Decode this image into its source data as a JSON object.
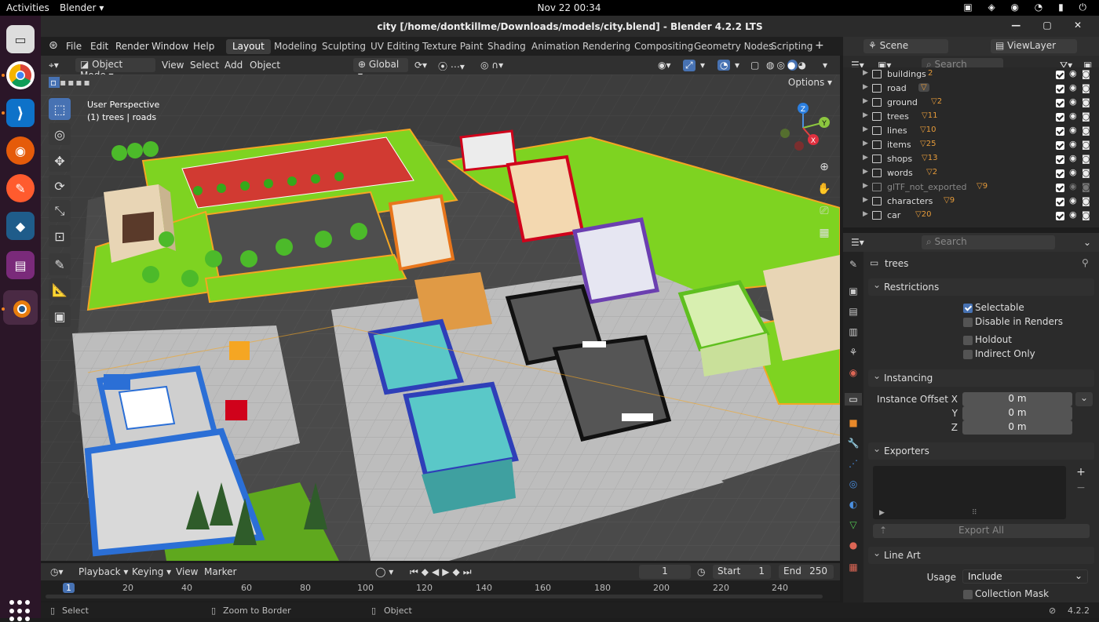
{
  "system": {
    "activities": "Activities",
    "app_name": "Blender",
    "clock": "Nov 22  00:34"
  },
  "window": {
    "title": "city [/home/dontkillme/Downloads/models/city.blend] - Blender 4.2.2 LTS"
  },
  "menu": {
    "items": [
      "File",
      "Edit",
      "Render",
      "Window",
      "Help"
    ]
  },
  "workspaces": {
    "tabs": [
      "Layout",
      "Modeling",
      "Sculpting",
      "UV Editing",
      "Texture Paint",
      "Shading",
      "Animation",
      "Rendering",
      "Compositing",
      "Geometry Nodes",
      "Scripting"
    ],
    "active": "Layout",
    "add": "+"
  },
  "scene": {
    "label": "Scene",
    "view_layer": "ViewLayer"
  },
  "viewport_header": {
    "mode": "Object Mode",
    "menus": [
      "View",
      "Select",
      "Add",
      "Object"
    ],
    "transform": "Global",
    "options": "Options"
  },
  "viewport": {
    "perspective": "User Perspective",
    "context": "(1) trees | roads"
  },
  "gizmo": {
    "x": "X",
    "y": "Y",
    "z": "Z"
  },
  "outliner": {
    "search_placeholder": "Search",
    "rows": [
      {
        "name": "buildings",
        "count": "2"
      },
      {
        "name": "road",
        "count": ""
      },
      {
        "name": "ground",
        "count": "2"
      },
      {
        "name": "trees",
        "count": "11"
      },
      {
        "name": "lines",
        "count": "10"
      },
      {
        "name": "items",
        "count": "25"
      },
      {
        "name": "shops",
        "count": "13"
      },
      {
        "name": "words",
        "count": "2"
      },
      {
        "name": "glTF_not_exported",
        "count": "9"
      },
      {
        "name": "characters",
        "count": "9"
      },
      {
        "name": "car",
        "count": "20"
      }
    ]
  },
  "properties": {
    "search_placeholder": "Search",
    "collection_name": "trees",
    "restrictions": {
      "title": "Restrictions",
      "selectable": "Selectable",
      "disable_renders": "Disable in Renders",
      "holdout": "Holdout",
      "indirect_only": "Indirect Only"
    },
    "instancing": {
      "title": "Instancing",
      "offset_x_label": "Instance Offset X",
      "y_label": "Y",
      "z_label": "Z",
      "x": "0 m",
      "y": "0 m",
      "z": "0 m"
    },
    "exporters": {
      "title": "Exporters",
      "export_all": "Export All"
    },
    "line_art": {
      "title": "Line Art",
      "usage_label": "Usage",
      "usage": "Include",
      "collection_mask": "Collection Mask"
    }
  },
  "timeline": {
    "menus": [
      "Playback",
      "Keying",
      "View",
      "Marker"
    ],
    "current_frame": "1",
    "start_label": "Start",
    "start": "1",
    "end_label": "End",
    "end": "250",
    "ticks": [
      "1",
      "20",
      "40",
      "60",
      "80",
      "100",
      "120",
      "140",
      "160",
      "180",
      "200",
      "220",
      "240"
    ]
  },
  "status": {
    "select": "Select",
    "zoom": "Zoom to Border",
    "object": "Object",
    "version": "4.2.2"
  }
}
